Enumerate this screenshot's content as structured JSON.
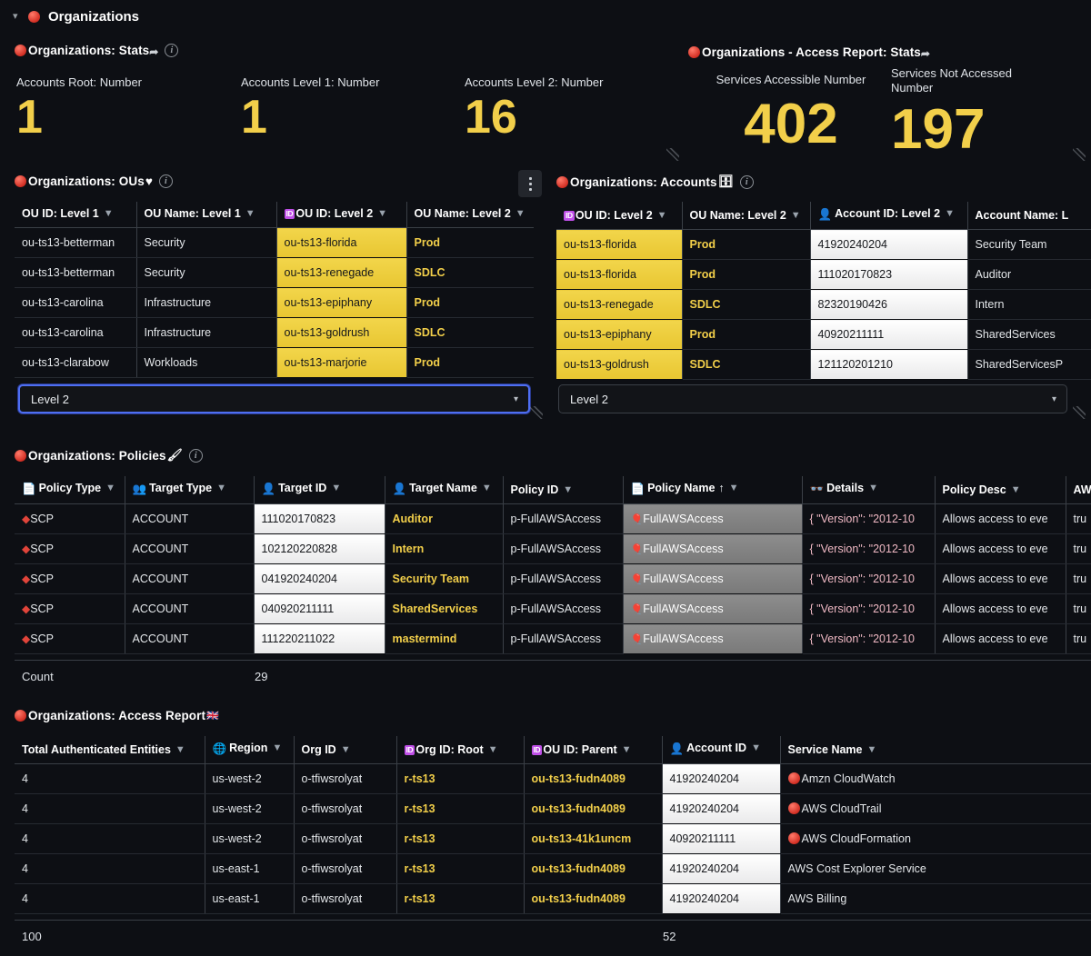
{
  "app": {
    "root_title": "Organizations",
    "collapse_icon": "chevron-down-icon"
  },
  "stats_left": {
    "title": "Organizations: Stats",
    "title_suffix_icon": "paper-plane-icon",
    "items": [
      {
        "label": "Accounts Root: Number",
        "value": "1"
      },
      {
        "label": "Accounts Level 1: Number",
        "value": "1"
      },
      {
        "label": "Accounts Level 2: Number",
        "value": "16"
      }
    ]
  },
  "stats_right": {
    "title": "Organizations - Access Report: Stats",
    "title_suffix_icon": "paper-plane-icon",
    "items": [
      {
        "label": "Services Accessible Number",
        "value": "402"
      },
      {
        "label": "Services Not Accessed Number",
        "value": "197"
      }
    ]
  },
  "ous_panel": {
    "title": "Organizations: OUs",
    "title_emoji": "♥",
    "menu_icon": "kebab-menu-icon",
    "columns": [
      {
        "label": "OU ID: Level 1",
        "icon": null,
        "filter": true
      },
      {
        "label": "OU Name: Level 1",
        "icon": null,
        "filter": true
      },
      {
        "label": "OU ID: Level 2",
        "icon": "id-badge",
        "filter": true
      },
      {
        "label": "OU Name: Level 2",
        "icon": null,
        "filter": true
      }
    ],
    "rows": [
      [
        "ou-ts13-betterman",
        "Security",
        "ou-ts13-florida",
        "Prod"
      ],
      [
        "ou-ts13-betterman",
        "Security",
        "ou-ts13-renegade",
        "SDLC"
      ],
      [
        "ou-ts13-carolina",
        "Infrastructure",
        "ou-ts13-epiphany",
        "Prod"
      ],
      [
        "ou-ts13-carolina",
        "Infrastructure",
        "ou-ts13-goldrush",
        "SDLC"
      ],
      [
        "ou-ts13-clarabow",
        "Workloads",
        "ou-ts13-marjorie",
        "Prod"
      ]
    ],
    "select": {
      "value": "Level 2",
      "focused": true
    }
  },
  "accounts_panel": {
    "title": "Organizations: Accounts",
    "title_emoji": "🗄",
    "columns": [
      {
        "label": "OU ID: Level 2",
        "icon": "id-badge",
        "filter": true
      },
      {
        "label": "OU Name: Level 2",
        "icon": null,
        "filter": true
      },
      {
        "label": "Account ID: Level 2",
        "icon": "person",
        "filter": true
      },
      {
        "label": "Account Name: L",
        "icon": null,
        "filter": false
      }
    ],
    "rows": [
      [
        "ou-ts13-florida",
        "Prod",
        "41920240204",
        "Security Team"
      ],
      [
        "ou-ts13-florida",
        "Prod",
        "111020170823",
        "Auditor"
      ],
      [
        "ou-ts13-renegade",
        "SDLC",
        "82320190426",
        "Intern"
      ],
      [
        "ou-ts13-epiphany",
        "Prod",
        "40920211111",
        "SharedServices"
      ],
      [
        "ou-ts13-goldrush",
        "SDLC",
        "121120201210",
        "SharedServicesP"
      ]
    ],
    "select": {
      "value": "Level 2",
      "focused": false
    }
  },
  "policies_panel": {
    "title": "Organizations: Policies",
    "title_emoji": "🖌",
    "columns": [
      {
        "label": "Policy Type",
        "icon": "page",
        "filter": true
      },
      {
        "label": "Target Type",
        "icon": "people",
        "filter": true
      },
      {
        "label": "Target ID",
        "icon": "person",
        "filter": true
      },
      {
        "label": "Target Name",
        "icon": "person",
        "filter": true
      },
      {
        "label": "Policy ID",
        "icon": null,
        "filter": true
      },
      {
        "label": "Policy Name",
        "icon": "page",
        "filter": true,
        "sort": "↑"
      },
      {
        "label": "Details",
        "icon": "eyes",
        "filter": true
      },
      {
        "label": "Policy Desc",
        "icon": null,
        "filter": true
      },
      {
        "label": "AW",
        "icon": null,
        "filter": false
      }
    ],
    "rows": [
      [
        "SCP",
        "ACCOUNT",
        "111020170823",
        "Auditor",
        "p-FullAWSAccess",
        "FullAWSAccess",
        "{ \"Version\": \"2012-10",
        "Allows access to eve",
        "tru"
      ],
      [
        "SCP",
        "ACCOUNT",
        "102120220828",
        "Intern",
        "p-FullAWSAccess",
        "FullAWSAccess",
        "{ \"Version\": \"2012-10",
        "Allows access to eve",
        "tru"
      ],
      [
        "SCP",
        "ACCOUNT",
        "041920240204",
        "Security Team",
        "p-FullAWSAccess",
        "FullAWSAccess",
        "{ \"Version\": \"2012-10",
        "Allows access to eve",
        "tru"
      ],
      [
        "SCP",
        "ACCOUNT",
        "040920211111",
        "SharedServices",
        "p-FullAWSAccess",
        "FullAWSAccess",
        "{ \"Version\": \"2012-10",
        "Allows access to eve",
        "tru"
      ],
      [
        "SCP",
        "ACCOUNT",
        "111220211022",
        "mastermind",
        "p-FullAWSAccess",
        "FullAWSAccess",
        "{ \"Version\": \"2012-10",
        "Allows access to eve",
        "tru"
      ]
    ],
    "footer": {
      "label": "Count",
      "value": "29"
    }
  },
  "access_report_panel": {
    "title": "Organizations: Access Report",
    "title_emoji": "🇬🇧",
    "columns": [
      {
        "label": "Total Authenticated Entities",
        "icon": null,
        "filter": true
      },
      {
        "label": "Region",
        "icon": "globe",
        "filter": true
      },
      {
        "label": "Org ID",
        "icon": null,
        "filter": true
      },
      {
        "label": "Org ID: Root",
        "icon": "id-badge",
        "filter": true
      },
      {
        "label": "OU ID: Parent",
        "icon": "id-badge",
        "filter": true
      },
      {
        "label": "Account ID",
        "icon": "person",
        "filter": true
      },
      {
        "label": "Service Name",
        "icon": null,
        "filter": true
      }
    ],
    "rows": [
      [
        "4",
        "us-west-2",
        "o-tfiwsrolyat",
        "r-ts13",
        "ou-ts13-fudn4089",
        "41920240204",
        "Amzn CloudWatch",
        true
      ],
      [
        "4",
        "us-west-2",
        "o-tfiwsrolyat",
        "r-ts13",
        "ou-ts13-fudn4089",
        "41920240204",
        "AWS CloudTrail",
        true
      ],
      [
        "4",
        "us-west-2",
        "o-tfiwsrolyat",
        "r-ts13",
        "ou-ts13-41k1uncm",
        "40920211111",
        "AWS CloudFormation",
        true
      ],
      [
        "4",
        "us-east-1",
        "o-tfiwsrolyat",
        "r-ts13",
        "ou-ts13-fudn4089",
        "41920240204",
        "AWS Cost Explorer Service",
        false
      ],
      [
        "4",
        "us-east-1",
        "o-tfiwsrolyat",
        "r-ts13",
        "ou-ts13-fudn4089",
        "41920240204",
        "AWS Billing",
        false
      ]
    ],
    "footer": {
      "col1": "100",
      "col6": "52"
    }
  },
  "colors": {
    "background": "#0d0f14",
    "accent_yellow": "#f2cf4a",
    "highlight_yellow": "#e8c631",
    "highlight_white": "#ffffff",
    "highlight_grey": "#838383",
    "focus_blue": "#4e6ef2",
    "id_badge_purple": "#c050e8",
    "details_pink": "#f0b9c4"
  }
}
